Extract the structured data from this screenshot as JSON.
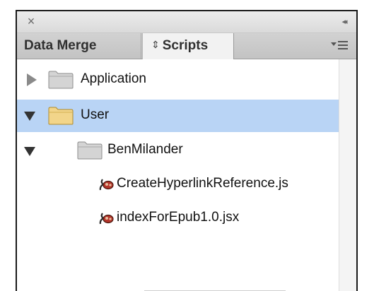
{
  "panel": {
    "close_symbol": "×",
    "collapse_symbol": "◂◂"
  },
  "tabs": {
    "data_merge": "Data Merge",
    "scripts": "Scripts",
    "scripts_prefix_symbol": "⇕"
  },
  "tree": [
    {
      "label": "Application",
      "expanded": false,
      "type": "folder",
      "level": 0,
      "selected": false,
      "icon": "folder-icon"
    },
    {
      "label": "User",
      "expanded": true,
      "type": "folder",
      "level": 0,
      "selected": true,
      "icon": "folder-icon"
    },
    {
      "label": "BenMilander",
      "expanded": true,
      "type": "folder",
      "level": 1,
      "selected": false,
      "icon": "folder-icon"
    },
    {
      "label": "CreateHyperlinkReference.js",
      "type": "script",
      "level": 2,
      "selected": false,
      "icon": "script-icon"
    },
    {
      "label": "indexForEpub1.0.jsx",
      "type": "script",
      "level": 2,
      "selected": false,
      "icon": "script-icon"
    }
  ],
  "colors": {
    "selection": "#b9d4f5",
    "user_folder": "#f2d58a",
    "gray_folder": "#d4d4d4"
  }
}
